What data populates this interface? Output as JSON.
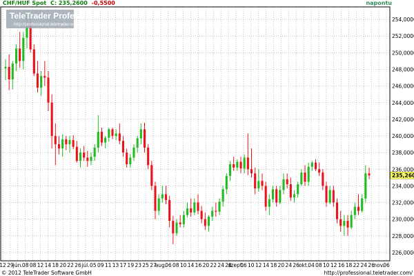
{
  "header": {
    "instrument": "CHF/HUF Spot",
    "last_label": "C: 235,2600",
    "change": "-0,5500",
    "period": "napontu",
    "colors": {
      "instrument": "#0a7a0a",
      "last": "#0a7a0a",
      "change": "#cc0000",
      "period": "#2e8b57"
    }
  },
  "logo": {
    "brand": "TeleTrader Professional",
    "url": "http://professional.teletrader.com/"
  },
  "footer": {
    "copyright": "© 2012 TeleTrader Software GmbH",
    "link": "http://professional.teletrader.com/"
  },
  "last_price_tag": "235,2600",
  "y_axis": {
    "ticks": [
      "254,0000",
      "252,0000",
      "250,0000",
      "248,0000",
      "246,0000",
      "244,0000",
      "242,0000",
      "240,0000",
      "238,0000",
      "236,0000",
      "234,0000",
      "232,0000",
      "230,0000",
      "228,0000",
      "226,0000"
    ]
  },
  "x_axis": {
    "labels": [
      "12",
      "29",
      "jún.",
      "08",
      "08",
      "12",
      "14",
      "18",
      "20",
      "22",
      "26",
      "júl.",
      "05",
      "09",
      "11",
      "13",
      "17",
      "19",
      "23",
      "25",
      "27",
      "aug.",
      "06",
      "08",
      "10",
      "14",
      "16",
      "20",
      "22",
      "24",
      "28",
      "szept.",
      "06",
      "10",
      "12",
      "14",
      "18",
      "20",
      "24",
      "26",
      "okt.",
      "04",
      "08",
      "10",
      "12",
      "16",
      "18",
      "22",
      "24",
      "26",
      "nov.",
      "06"
    ]
  },
  "colors": {
    "up": "#22bb22",
    "down": "#e8141c",
    "grid": "#9a9a9a",
    "price_tag": "#ffff66"
  },
  "chart_data": {
    "type": "candlestick",
    "ylim": [
      225,
      255.5
    ],
    "grid": true,
    "candles": [
      {
        "o": 248.1,
        "h": 249.2,
        "l": 246.7,
        "c": 248.3
      },
      {
        "o": 248.3,
        "h": 249.8,
        "l": 245.5,
        "c": 246.8
      },
      {
        "o": 246.8,
        "h": 249.0,
        "l": 245.6,
        "c": 248.7
      },
      {
        "o": 248.7,
        "h": 251.0,
        "l": 247.8,
        "c": 250.5
      },
      {
        "o": 250.5,
        "h": 252.5,
        "l": 248.2,
        "c": 249.0
      },
      {
        "o": 249.0,
        "h": 252.5,
        "l": 248.0,
        "c": 251.8
      },
      {
        "o": 251.8,
        "h": 255.0,
        "l": 250.5,
        "c": 253.2
      },
      {
        "o": 253.2,
        "h": 254.2,
        "l": 250.0,
        "c": 250.4
      },
      {
        "o": 250.4,
        "h": 251.0,
        "l": 247.2,
        "c": 247.5
      },
      {
        "o": 247.5,
        "h": 249.0,
        "l": 245.2,
        "c": 245.8
      },
      {
        "o": 245.8,
        "h": 247.8,
        "l": 244.8,
        "c": 247.2
      },
      {
        "o": 247.2,
        "h": 249.0,
        "l": 246.0,
        "c": 247.0
      },
      {
        "o": 247.0,
        "h": 247.8,
        "l": 243.0,
        "c": 244.0
      },
      {
        "o": 244.0,
        "h": 245.0,
        "l": 238.5,
        "c": 240.0
      },
      {
        "o": 240.0,
        "h": 241.5,
        "l": 236.5,
        "c": 239.0
      },
      {
        "o": 239.0,
        "h": 240.0,
        "l": 237.8,
        "c": 238.5
      },
      {
        "o": 238.5,
        "h": 240.2,
        "l": 237.5,
        "c": 239.6
      },
      {
        "o": 239.6,
        "h": 240.0,
        "l": 238.3,
        "c": 239.0
      },
      {
        "o": 239.0,
        "h": 240.0,
        "l": 238.0,
        "c": 239.5
      },
      {
        "o": 239.5,
        "h": 240.1,
        "l": 238.4,
        "c": 238.7
      },
      {
        "o": 238.7,
        "h": 239.4,
        "l": 236.8,
        "c": 237.0
      },
      {
        "o": 237.0,
        "h": 238.5,
        "l": 236.2,
        "c": 238.0
      },
      {
        "o": 238.0,
        "h": 238.8,
        "l": 237.0,
        "c": 237.4
      },
      {
        "o": 237.4,
        "h": 238.2,
        "l": 236.3,
        "c": 237.0
      },
      {
        "o": 237.0,
        "h": 238.0,
        "l": 236.5,
        "c": 237.5
      },
      {
        "o": 237.5,
        "h": 239.0,
        "l": 237.0,
        "c": 238.6
      },
      {
        "o": 238.6,
        "h": 242.5,
        "l": 238.0,
        "c": 240.5
      },
      {
        "o": 240.5,
        "h": 241.0,
        "l": 238.8,
        "c": 239.2
      },
      {
        "o": 239.2,
        "h": 240.0,
        "l": 238.5,
        "c": 239.8
      },
      {
        "o": 239.8,
        "h": 241.0,
        "l": 239.3,
        "c": 240.8
      },
      {
        "o": 240.8,
        "h": 241.0,
        "l": 239.6,
        "c": 240.0
      },
      {
        "o": 240.0,
        "h": 240.8,
        "l": 239.5,
        "c": 240.3
      },
      {
        "o": 240.3,
        "h": 241.5,
        "l": 239.0,
        "c": 239.4
      },
      {
        "o": 239.4,
        "h": 240.0,
        "l": 237.5,
        "c": 238.0
      },
      {
        "o": 238.0,
        "h": 238.5,
        "l": 236.2,
        "c": 236.6
      },
      {
        "o": 236.6,
        "h": 237.8,
        "l": 236.2,
        "c": 237.4
      },
      {
        "o": 237.4,
        "h": 239.0,
        "l": 237.0,
        "c": 238.6
      },
      {
        "o": 238.6,
        "h": 240.0,
        "l": 238.0,
        "c": 239.7
      },
      {
        "o": 239.7,
        "h": 241.5,
        "l": 239.0,
        "c": 240.8
      },
      {
        "o": 240.8,
        "h": 241.6,
        "l": 238.0,
        "c": 238.6
      },
      {
        "o": 238.6,
        "h": 239.0,
        "l": 236.0,
        "c": 236.5
      },
      {
        "o": 236.5,
        "h": 237.0,
        "l": 233.5,
        "c": 234.0
      },
      {
        "o": 234.0,
        "h": 234.5,
        "l": 230.0,
        "c": 231.0
      },
      {
        "o": 231.0,
        "h": 233.0,
        "l": 230.5,
        "c": 232.5
      },
      {
        "o": 232.5,
        "h": 234.0,
        "l": 232.0,
        "c": 233.0
      },
      {
        "o": 233.0,
        "h": 234.0,
        "l": 231.8,
        "c": 232.3
      },
      {
        "o": 232.3,
        "h": 232.8,
        "l": 229.0,
        "c": 229.8
      },
      {
        "o": 229.8,
        "h": 230.4,
        "l": 227.0,
        "c": 228.3
      },
      {
        "o": 228.3,
        "h": 230.0,
        "l": 228.0,
        "c": 229.6
      },
      {
        "o": 229.6,
        "h": 230.5,
        "l": 229.0,
        "c": 229.4
      },
      {
        "o": 229.4,
        "h": 231.0,
        "l": 229.0,
        "c": 230.5
      },
      {
        "o": 230.5,
        "h": 232.0,
        "l": 230.2,
        "c": 231.3
      },
      {
        "o": 231.3,
        "h": 232.5,
        "l": 230.3,
        "c": 230.8
      },
      {
        "o": 230.8,
        "h": 232.5,
        "l": 230.5,
        "c": 232.0
      },
      {
        "o": 232.0,
        "h": 233.0,
        "l": 230.6,
        "c": 231.0
      },
      {
        "o": 231.0,
        "h": 231.6,
        "l": 229.5,
        "c": 230.0
      },
      {
        "o": 230.0,
        "h": 230.8,
        "l": 228.7,
        "c": 229.2
      },
      {
        "o": 229.2,
        "h": 230.5,
        "l": 228.5,
        "c": 230.3
      },
      {
        "o": 230.3,
        "h": 231.5,
        "l": 229.8,
        "c": 231.0
      },
      {
        "o": 231.0,
        "h": 232.0,
        "l": 230.3,
        "c": 230.9
      },
      {
        "o": 230.9,
        "h": 232.5,
        "l": 230.5,
        "c": 232.1
      },
      {
        "o": 232.1,
        "h": 234.0,
        "l": 231.5,
        "c": 233.6
      },
      {
        "o": 233.6,
        "h": 235.5,
        "l": 233.0,
        "c": 235.2
      },
      {
        "o": 235.2,
        "h": 237.0,
        "l": 234.6,
        "c": 236.6
      },
      {
        "o": 236.6,
        "h": 237.5,
        "l": 235.8,
        "c": 236.2
      },
      {
        "o": 236.2,
        "h": 237.2,
        "l": 235.8,
        "c": 236.9
      },
      {
        "o": 236.9,
        "h": 237.5,
        "l": 235.5,
        "c": 236.1
      },
      {
        "o": 236.1,
        "h": 237.8,
        "l": 235.5,
        "c": 237.4
      },
      {
        "o": 237.4,
        "h": 240.3,
        "l": 235.3,
        "c": 236.0
      },
      {
        "o": 236.0,
        "h": 238.5,
        "l": 235.0,
        "c": 235.5
      },
      {
        "o": 235.5,
        "h": 236.2,
        "l": 233.0,
        "c": 233.7
      },
      {
        "o": 233.7,
        "h": 236.0,
        "l": 233.3,
        "c": 234.6
      },
      {
        "o": 234.6,
        "h": 235.5,
        "l": 233.5,
        "c": 234.0
      },
      {
        "o": 234.0,
        "h": 234.5,
        "l": 231.0,
        "c": 231.5
      },
      {
        "o": 231.5,
        "h": 233.0,
        "l": 230.5,
        "c": 232.4
      },
      {
        "o": 232.4,
        "h": 234.0,
        "l": 232.0,
        "c": 233.6
      },
      {
        "o": 233.6,
        "h": 234.0,
        "l": 231.5,
        "c": 232.0
      },
      {
        "o": 232.0,
        "h": 234.0,
        "l": 231.8,
        "c": 233.5
      },
      {
        "o": 233.5,
        "h": 235.5,
        "l": 233.0,
        "c": 234.8
      },
      {
        "o": 234.8,
        "h": 235.5,
        "l": 233.7,
        "c": 234.2
      },
      {
        "o": 234.2,
        "h": 235.0,
        "l": 232.2,
        "c": 232.6
      },
      {
        "o": 232.6,
        "h": 233.5,
        "l": 232.0,
        "c": 233.0
      },
      {
        "o": 233.0,
        "h": 234.5,
        "l": 232.6,
        "c": 234.2
      },
      {
        "o": 234.2,
        "h": 236.0,
        "l": 234.0,
        "c": 235.6
      },
      {
        "o": 235.6,
        "h": 236.5,
        "l": 234.0,
        "c": 234.5
      },
      {
        "o": 234.5,
        "h": 236.8,
        "l": 234.0,
        "c": 236.3
      },
      {
        "o": 236.3,
        "h": 237.0,
        "l": 235.8,
        "c": 236.8
      },
      {
        "o": 236.8,
        "h": 237.2,
        "l": 235.8,
        "c": 236.0
      },
      {
        "o": 236.0,
        "h": 236.8,
        "l": 235.2,
        "c": 235.6
      },
      {
        "o": 235.6,
        "h": 236.0,
        "l": 233.5,
        "c": 234.0
      },
      {
        "o": 234.0,
        "h": 234.5,
        "l": 231.5,
        "c": 232.0
      },
      {
        "o": 232.0,
        "h": 234.0,
        "l": 231.8,
        "c": 233.5
      },
      {
        "o": 233.5,
        "h": 234.0,
        "l": 231.5,
        "c": 232.0
      },
      {
        "o": 232.0,
        "h": 232.5,
        "l": 229.5,
        "c": 230.0
      },
      {
        "o": 230.0,
        "h": 231.0,
        "l": 228.5,
        "c": 229.2
      },
      {
        "o": 229.2,
        "h": 230.5,
        "l": 228.0,
        "c": 229.8
      },
      {
        "o": 229.8,
        "h": 230.5,
        "l": 228.0,
        "c": 229.0
      },
      {
        "o": 229.0,
        "h": 231.0,
        "l": 228.8,
        "c": 230.5
      },
      {
        "o": 230.5,
        "h": 232.0,
        "l": 230.0,
        "c": 231.5
      },
      {
        "o": 231.5,
        "h": 233.0,
        "l": 230.5,
        "c": 231.0
      },
      {
        "o": 231.0,
        "h": 233.0,
        "l": 230.8,
        "c": 232.5
      },
      {
        "o": 232.5,
        "h": 236.5,
        "l": 232.0,
        "c": 235.5
      },
      {
        "o": 235.5,
        "h": 236.2,
        "l": 234.8,
        "c": 235.26
      }
    ]
  }
}
